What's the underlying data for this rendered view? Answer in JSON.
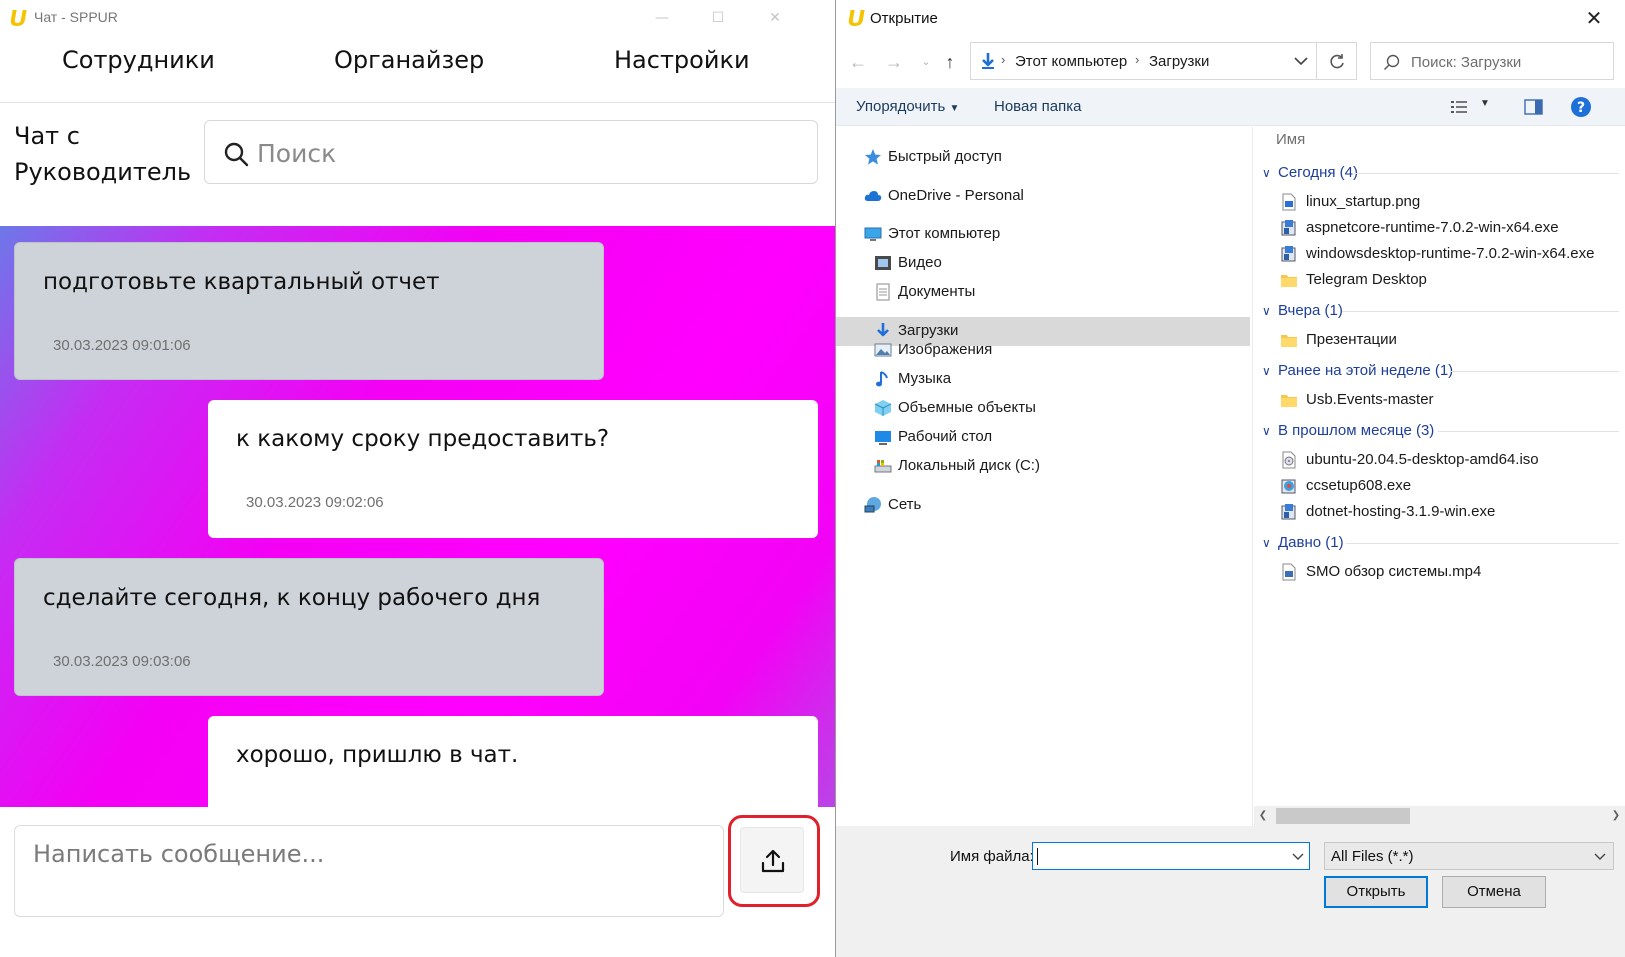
{
  "chat_app": {
    "window_title": "Чат - SPPUR",
    "nav": [
      "Сотрудники",
      "Органайзер",
      "Настройки"
    ],
    "chat_title_line1": "Чат с",
    "chat_title_line2": "Руководитель",
    "search_placeholder": "Поиск",
    "messages": [
      {
        "direction": "in",
        "text": "подготовьте квартальный отчет",
        "time": "30.03.2023 09:01:06"
      },
      {
        "direction": "out",
        "text": "к какому сроку предоставить?",
        "time": "30.03.2023 09:02:06"
      },
      {
        "direction": "in",
        "text": "сделайте сегодня, к концу рабочего дня",
        "time": "30.03.2023 09:03:06"
      },
      {
        "direction": "out",
        "text": "хорошо, пришлю в чат.",
        "time": ""
      }
    ],
    "composer_placeholder": "Написать сообщение...",
    "upload_icon": "upload-icon",
    "highlight_color": "#e0202a"
  },
  "file_dialog": {
    "title": "Открытие",
    "breadcrumb": [
      "Этот компьютер",
      "Загрузки"
    ],
    "search_placeholder": "Поиск: Загрузки",
    "toolbar": {
      "organize": "Упорядочить",
      "new_folder": "Новая папка"
    },
    "nav_pane": [
      {
        "label": "Быстрый доступ",
        "icon": "star-icon"
      },
      {
        "label": "OneDrive - Personal",
        "icon": "cloud-icon"
      },
      {
        "label": "Этот компьютер",
        "icon": "computer-icon"
      },
      {
        "label": "Видео",
        "icon": "video-icon"
      },
      {
        "label": "Документы",
        "icon": "document-icon"
      },
      {
        "label": "Загрузки",
        "icon": "download-icon",
        "selected": true
      },
      {
        "label": "Изображения",
        "icon": "image-icon"
      },
      {
        "label": "Музыка",
        "icon": "music-icon"
      },
      {
        "label": "Объемные объекты",
        "icon": "cube-icon"
      },
      {
        "label": "Рабочий стол",
        "icon": "desktop-icon"
      },
      {
        "label": "Локальный диск (C:)",
        "icon": "drive-icon"
      },
      {
        "label": "Сеть",
        "icon": "network-icon"
      }
    ],
    "column_header": "Имя",
    "groups": [
      {
        "label": "Сегодня (4)",
        "items": [
          {
            "name": "linux_startup.png",
            "icon": "image-file-icon"
          },
          {
            "name": "aspnetcore-runtime-7.0.2-win-x64.exe",
            "icon": "installer-icon"
          },
          {
            "name": "windowsdesktop-runtime-7.0.2-win-x64.exe",
            "icon": "installer-icon"
          },
          {
            "name": "Telegram Desktop",
            "icon": "folder-icon"
          }
        ]
      },
      {
        "label": "Вчера (1)",
        "items": [
          {
            "name": "Презентации",
            "icon": "folder-icon"
          }
        ]
      },
      {
        "label": "Ранее на этой неделе (1)",
        "items": [
          {
            "name": "Usb.Events-master",
            "icon": "folder-icon"
          }
        ]
      },
      {
        "label": "В прошлом месяце (3)",
        "items": [
          {
            "name": "ubuntu-20.04.5-desktop-amd64.iso",
            "icon": "disc-image-icon"
          },
          {
            "name": "ccsetup608.exe",
            "icon": "installer-icon"
          },
          {
            "name": "dotnet-hosting-3.1.9-win.exe",
            "icon": "installer-icon"
          }
        ]
      },
      {
        "label": "Давно (1)",
        "items": [
          {
            "name": "SMO обзор системы.mp4",
            "icon": "video-file-icon"
          }
        ]
      }
    ],
    "filename_label": "Имя файла:",
    "filename_value": "",
    "filetype": "All Files (*.*)",
    "open_button": "Открыть",
    "cancel_button": "Отмена"
  }
}
